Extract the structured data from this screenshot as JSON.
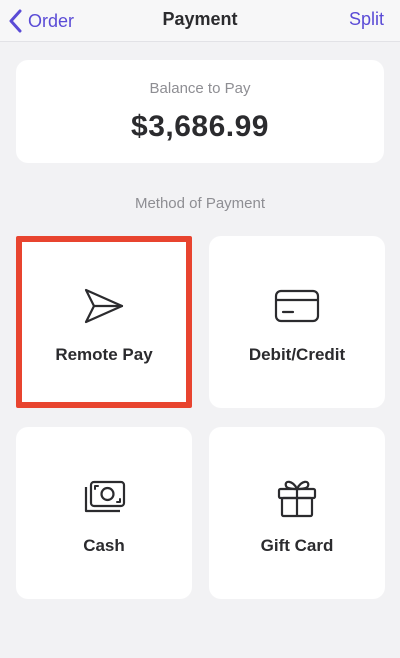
{
  "nav": {
    "back_label": "Order",
    "title": "Payment",
    "split_label": "Split"
  },
  "balance": {
    "label": "Balance to Pay",
    "amount": "$3,686.99"
  },
  "methods": {
    "section_label": "Method of Payment",
    "items": [
      {
        "label": "Remote Pay",
        "icon": "paper-plane-icon",
        "selected": true
      },
      {
        "label": "Debit/Credit",
        "icon": "credit-card-icon",
        "selected": false
      },
      {
        "label": "Cash",
        "icon": "cash-icon",
        "selected": false
      },
      {
        "label": "Gift Card",
        "icon": "gift-icon",
        "selected": false
      }
    ]
  },
  "colors": {
    "accent": "#5a4bd6",
    "selection_border": "#e8442f",
    "background": "#f2f2f4"
  }
}
